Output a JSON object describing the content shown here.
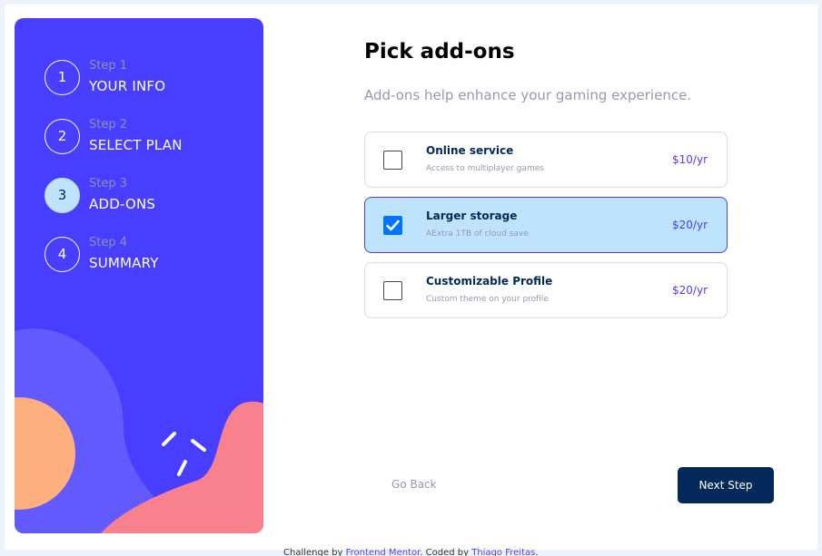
{
  "sidebar": {
    "steps": [
      {
        "number": "1",
        "sub": "Step 1",
        "title": "YOUR INFO",
        "active": false
      },
      {
        "number": "2",
        "sub": "Step 2",
        "title": "SELECT PLAN",
        "active": false
      },
      {
        "number": "3",
        "sub": "Step 3",
        "title": "ADD-ONS",
        "active": true
      },
      {
        "number": "4",
        "sub": "Step 4",
        "title": "SUMMARY",
        "active": false
      }
    ]
  },
  "main": {
    "title": "Pick add-ons",
    "subtitle": "Add-ons help enhance your gaming experience.",
    "addons": [
      {
        "name": "Online service",
        "desc": "Access to multiplayer games",
        "price": "$10/yr",
        "checked": false
      },
      {
        "name": "Larger storage",
        "desc": "AExtra 1TB of cloud save",
        "price": "$20/yr",
        "checked": true
      },
      {
        "name": "Customizable Profile",
        "desc": "Custom theme on your profile",
        "price": "$20/yr",
        "checked": false
      }
    ],
    "back_label": "Go Back",
    "next_label": "Next Step"
  },
  "footer": {
    "prefix": "Challenge by ",
    "link1": "Frontend Mentor",
    "middle": ". Coded by ",
    "link2": "Thiago Freitas",
    "suffix": "."
  },
  "colors": {
    "sidebar_bg": "#483eff",
    "active_step": "#bfe2fd",
    "next_button": "#02295a",
    "price": "#483eff",
    "checkbox": "#0075ff"
  }
}
